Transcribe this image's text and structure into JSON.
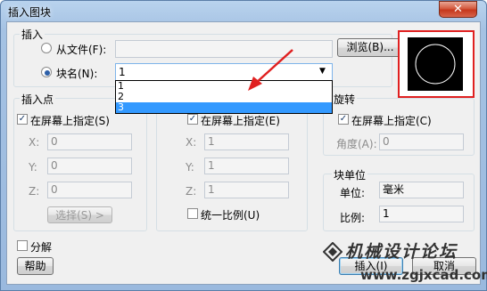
{
  "window": {
    "title": "插入图块",
    "close_glyph": "✕"
  },
  "insert_group": {
    "label": "插入",
    "from_file_label": "从文件(F):",
    "from_file_value": "",
    "browse_button": "浏览(B)...",
    "block_name_label": "块名(N):",
    "block_name_value": "1",
    "dropdown_options": [
      "1",
      "2",
      "3"
    ],
    "dropdown_selected": "3"
  },
  "insertion_point": {
    "label": "插入点",
    "specify_on_screen": "在屏幕上指定(S)",
    "x_label": "X:",
    "x_value": "0",
    "y_label": "Y:",
    "y_value": "0",
    "z_label": "Z:",
    "z_value": "0",
    "pick_button": "选择(S) >"
  },
  "scale": {
    "specify_on_screen": "在屏幕上指定(E)",
    "x_label": "X:",
    "x_value": "1",
    "y_label": "Y:",
    "y_value": "1",
    "z_label": "Z:",
    "z_value": "1",
    "uniform_scale": "统一比例(U)"
  },
  "rotation": {
    "label": "旋转",
    "specify_on_screen": "在屏幕上指定(C)",
    "angle_label": "角度(A):",
    "angle_value": "0"
  },
  "block_unit": {
    "label": "块单位",
    "unit_label": "单位:",
    "unit_value": "毫米",
    "ratio_label": "比例:",
    "ratio_value": "1"
  },
  "explode_label": "分解",
  "help_button": "帮助",
  "insert_button": "插入(I)",
  "cancel_button": "取消",
  "watermark": {
    "text": "机械设计论坛",
    "url": "www.zgjxcad.com"
  },
  "colors": {
    "annotation_red": "#e02020",
    "accent_blue": "#3399ff"
  }
}
